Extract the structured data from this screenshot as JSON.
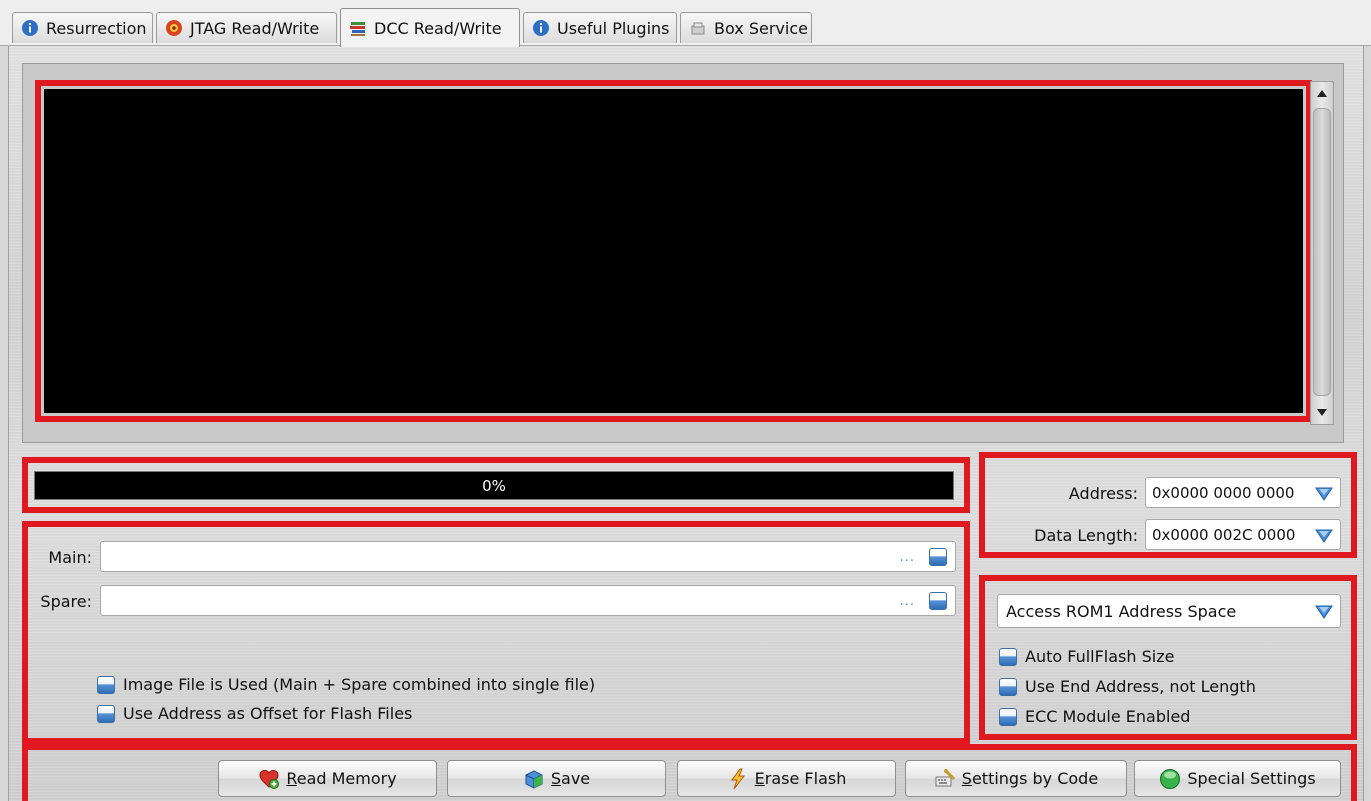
{
  "tabs": [
    {
      "label": "Resurrection",
      "icon": "info-icon"
    },
    {
      "label": "JTAG Read/Write",
      "icon": "chip-icon"
    },
    {
      "label": "DCC Read/Write",
      "icon": "books-icon",
      "active": true
    },
    {
      "label": "Useful Plugins",
      "icon": "info-icon"
    },
    {
      "label": "Box Service",
      "icon": "box-icon"
    }
  ],
  "progress": {
    "text": "0%",
    "value": 0
  },
  "files": {
    "main_label": "Main:",
    "main_value": "",
    "spare_label": "Spare:",
    "spare_value": "",
    "browse_hint": "..."
  },
  "options": {
    "image_file_used": {
      "label": "Image File is Used (Main + Spare combined into single file)",
      "checked": false
    },
    "address_as_offset": {
      "label": "Use Address as Offset for Flash Files",
      "checked": false
    }
  },
  "address": {
    "label": "Address:",
    "value": "0x0000 0000 0000",
    "length_label": "Data Length:",
    "length_value": "0x0000 002C 0000"
  },
  "rom": {
    "space_selected": "Access ROM1 Address Space",
    "auto_fullflash": {
      "label": "Auto FullFlash Size",
      "checked": false
    },
    "use_end_address": {
      "label": "Use End Address, not Length",
      "checked": false
    },
    "ecc_enabled": {
      "label": "ECC Module Enabled",
      "checked": false
    }
  },
  "buttons": {
    "read_memory": {
      "underline": "R",
      "rest": "ead Memory"
    },
    "save": {
      "underline": "S",
      "rest": "ave"
    },
    "erase_flash": {
      "underline": "E",
      "rest": "rase Flash"
    },
    "settings_by_code": {
      "underline": "S",
      "rest": "ettings by Code"
    },
    "special_settings": {
      "label": "Special Settings"
    }
  },
  "colors": {
    "highlight_red": "#e0181f",
    "console_bg": "#000000",
    "accent_blue": "#2f6fb8"
  }
}
